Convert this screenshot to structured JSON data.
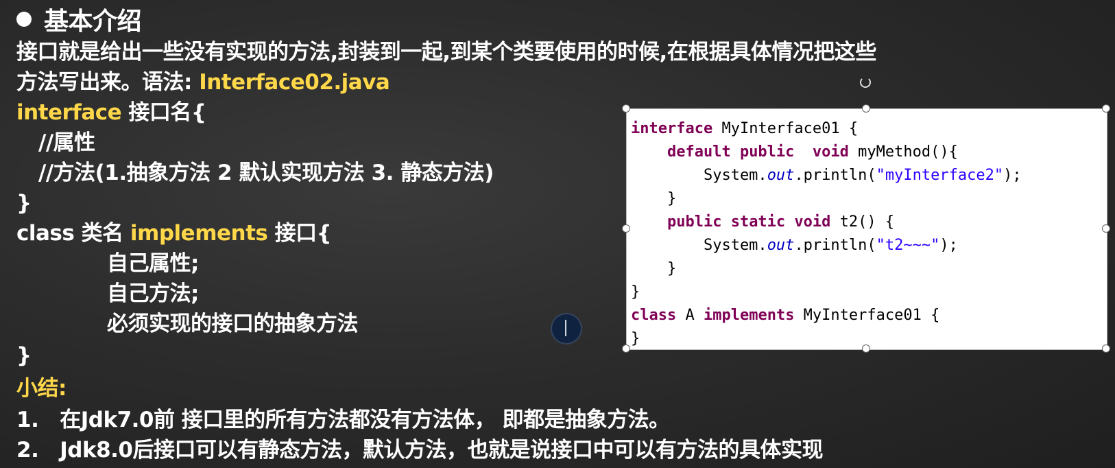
{
  "slide": {
    "title": "基本介绍",
    "intro_line1": "接口就是给出一些没有实现的方法,封装到一起,到某个类要使用的时候,在根据具体情况把这些",
    "intro_line2_prefix": "方法写出来。语法: ",
    "intro_line2_file": "Interface02.java",
    "syntax": {
      "interface_kw": "interface",
      "interface_name": " 接口名{",
      "comment_attr": "//属性",
      "comment_methods": "//方法(1.抽象方法 2 默认实现方法 3. 静态方法)",
      "close_brace_1": "}",
      "class_prefix": "class 类名 ",
      "implements_kw": "implements",
      "class_suffix": " 接口{",
      "own_attr": "自己属性;",
      "own_method": "自己方法;",
      "must_impl": "必须实现的接口的抽象方法",
      "close_brace_2": "}"
    },
    "summary": {
      "heading": "小结:",
      "item1": "1.   在Jdk7.0前 接口里的所有方法都没有方法体， 即都是抽象方法。",
      "item2": "2.   Jdk8.0后接口可以有静态方法，默认方法，也就是说接口中可以有方法的具体实现"
    },
    "code_image": {
      "l1_kw": "interface",
      "l1_rest": " MyInterface01 {",
      "l2_indent": "    ",
      "l2_kw": "default public",
      "l2_mid": "  ",
      "l2_kw2": "void",
      "l2_rest": " myMethod(){",
      "l3_pre": "        System.",
      "l3_out": "out",
      "l3_mid": ".println(",
      "l3_str": "\"myInterface2\"",
      "l3_end": ");",
      "l4": "    }",
      "l5_indent": "    ",
      "l5_kw": "public static void",
      "l5_rest": " t2() {",
      "l6_pre": "        System.",
      "l6_out": "out",
      "l6_mid": ".println(",
      "l6_str": "\"t2~~~\"",
      "l6_end": ");",
      "l7": "    }",
      "l8": "}",
      "l9_kw": "class",
      "l9_mid": " A ",
      "l9_kw2": "implements",
      "l9_rest": " MyInterface01 {",
      "l10": "}"
    }
  }
}
